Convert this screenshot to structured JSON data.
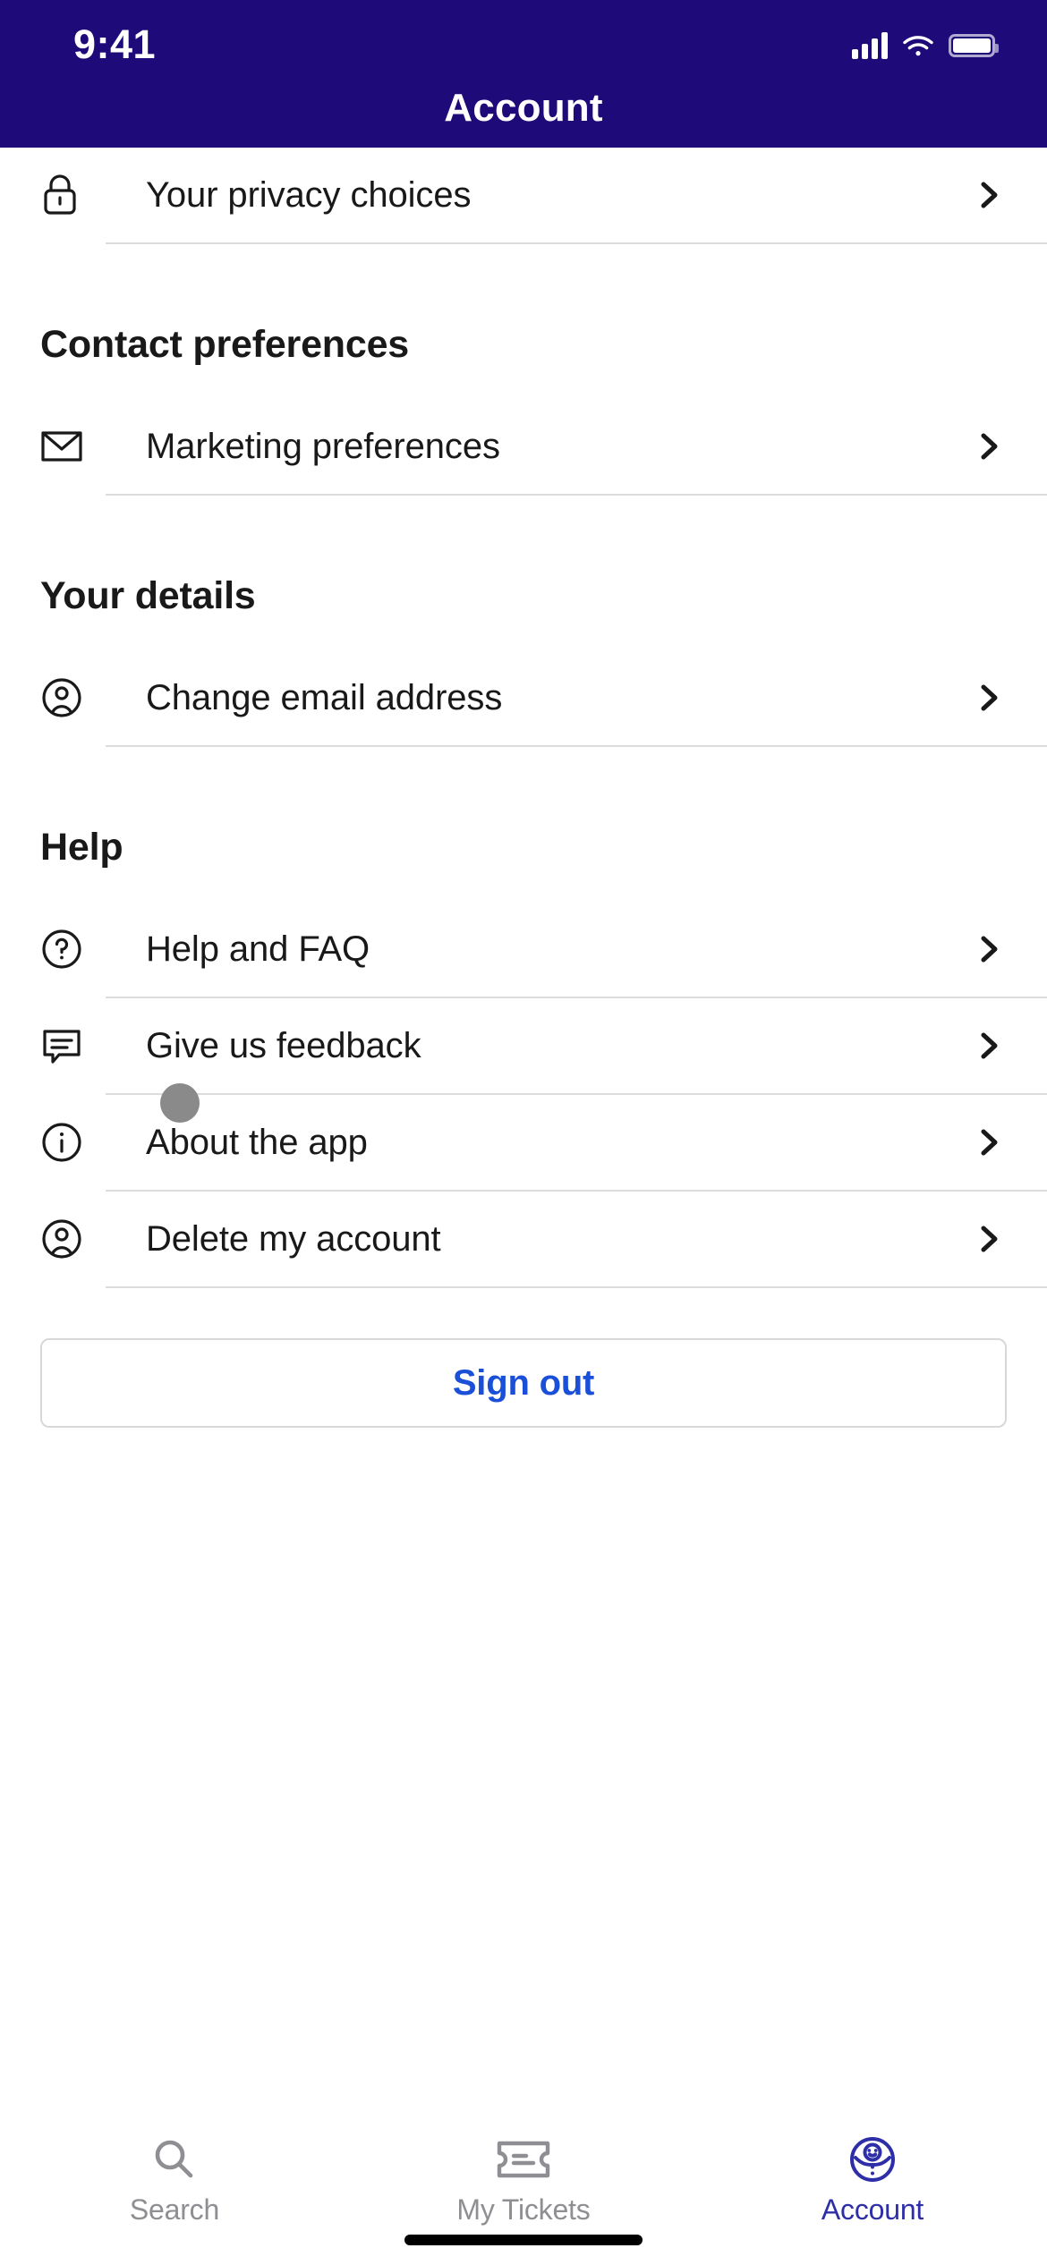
{
  "status_bar": {
    "time": "9:41",
    "signal_icon": "cellular-signal-icon",
    "wifi_icon": "wifi-icon",
    "battery_icon": "battery-icon"
  },
  "header": {
    "title": "Account",
    "background_color": "#1e0a78",
    "text_color": "#ffffff"
  },
  "sections": [
    {
      "heading": null,
      "items": [
        {
          "label": "Your privacy choices",
          "icon": "lock-icon",
          "chevron": "chevron-right-icon"
        }
      ]
    },
    {
      "heading": "Contact preferences",
      "items": [
        {
          "label": "Marketing preferences",
          "icon": "envelope-icon",
          "chevron": "chevron-right-icon"
        }
      ]
    },
    {
      "heading": "Your details",
      "items": [
        {
          "label": "Change email address",
          "icon": "person-circle-icon",
          "chevron": "chevron-right-icon"
        }
      ]
    },
    {
      "heading": "Help",
      "items": [
        {
          "label": "Help and FAQ",
          "icon": "question-circle-icon",
          "chevron": "chevron-right-icon"
        },
        {
          "label": "Give us feedback",
          "icon": "speech-bubble-icon",
          "chevron": "chevron-right-icon"
        },
        {
          "label": "About the app",
          "icon": "info-circle-icon",
          "chevron": "chevron-right-icon"
        },
        {
          "label": "Delete my account",
          "icon": "person-circle-icon",
          "chevron": "chevron-right-icon"
        }
      ]
    }
  ],
  "sign_out": {
    "label": "Sign out",
    "text_color": "#1a4fd8",
    "border_color": "#d8d8d8"
  },
  "tab_bar": {
    "inactive_color": "#8e8e93",
    "active_color": "#2e2fa8",
    "tabs": [
      {
        "label": "Search",
        "icon": "search-icon",
        "active": false
      },
      {
        "label": "My Tickets",
        "icon": "ticket-icon",
        "active": false
      },
      {
        "label": "Account",
        "icon": "account-avatar-icon",
        "active": true
      }
    ]
  },
  "overlay": {
    "touch_indicator": "touch-point-indicator",
    "home_indicator": "home-indicator"
  }
}
